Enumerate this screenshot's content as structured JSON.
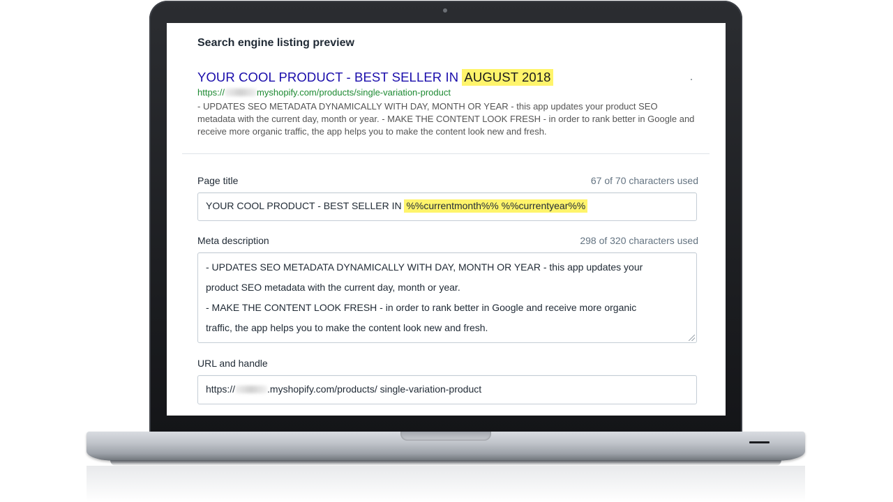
{
  "preview": {
    "heading": "Search engine listing preview",
    "title_plain": "YOUR COOL PRODUCT - BEST SELLER IN ",
    "title_highlight": "AUGUST 2018",
    "url_prefix": "https://",
    "url_suffix": "myshopify.com/products/single-variation-product",
    "description": "- UPDATES SEO METADATA DYNAMICALLY WITH DAY, MONTH OR YEAR - this app updates your product SEO metadata with the current day, month or year. - MAKE THE CONTENT LOOK FRESH - in order to rank better in Google and receive more organic traffic, the app helps you to make the content look new and fresh."
  },
  "page_title": {
    "label": "Page title",
    "count": "67 of 70 characters used",
    "value_plain": "YOUR COOL PRODUCT - BEST SELLER IN ",
    "value_highlight": "%%currentmonth%% %%currentyear%%"
  },
  "meta_description": {
    "label": "Meta description",
    "count": "298 of 320 characters used",
    "line1": "- UPDATES SEO METADATA DYNAMICALLY WITH DAY, MONTH OR YEAR - this app updates your",
    "line2": "product SEO metadata with the current day, month or year.",
    "line3": "- MAKE THE CONTENT LOOK FRESH - in order to rank better in Google and receive more organic",
    "line4": "traffic, the app helps you to make the content look new and fresh."
  },
  "url_handle": {
    "label": "URL and handle",
    "prefix": "https://",
    "suffix": ".myshopify.com/products/ single-variation-product"
  },
  "colors": {
    "serp_title": "#1a0dab",
    "serp_url": "#1e8a33",
    "highlight": "#fff46b"
  }
}
